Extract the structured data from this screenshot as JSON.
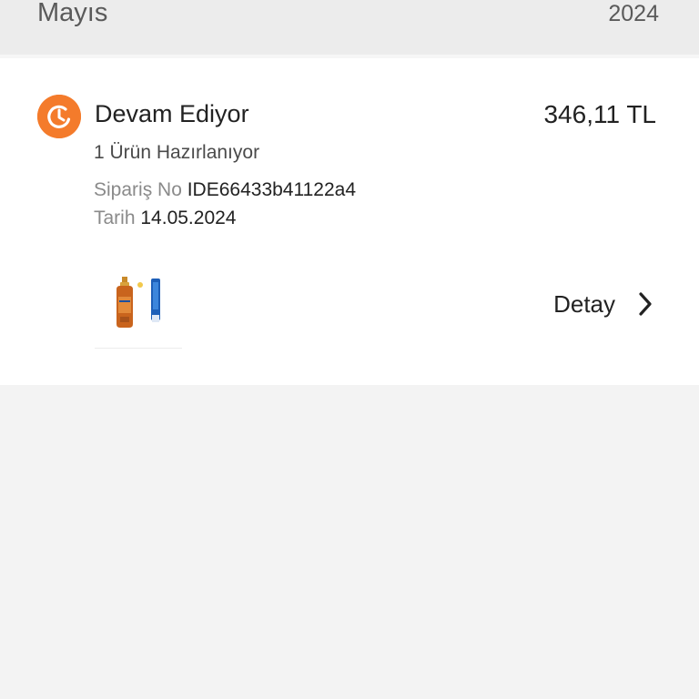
{
  "header": {
    "month": "Mayıs",
    "year": "2024"
  },
  "order": {
    "status": "Devam Ediyor",
    "status_icon": "clock-icon",
    "status_color": "#f47b2b",
    "price": "346,11 TL",
    "item_status": "1 Ürün Hazırlanıyor",
    "order_no_label": "Sipariş No",
    "order_no": "IDE66433b41122a4",
    "date_label": "Tarih",
    "date": "14.05.2024",
    "product_image": "sunscreen-product-thumbnail",
    "detail_label": "Detay",
    "detail_icon": "chevron-right-icon"
  }
}
